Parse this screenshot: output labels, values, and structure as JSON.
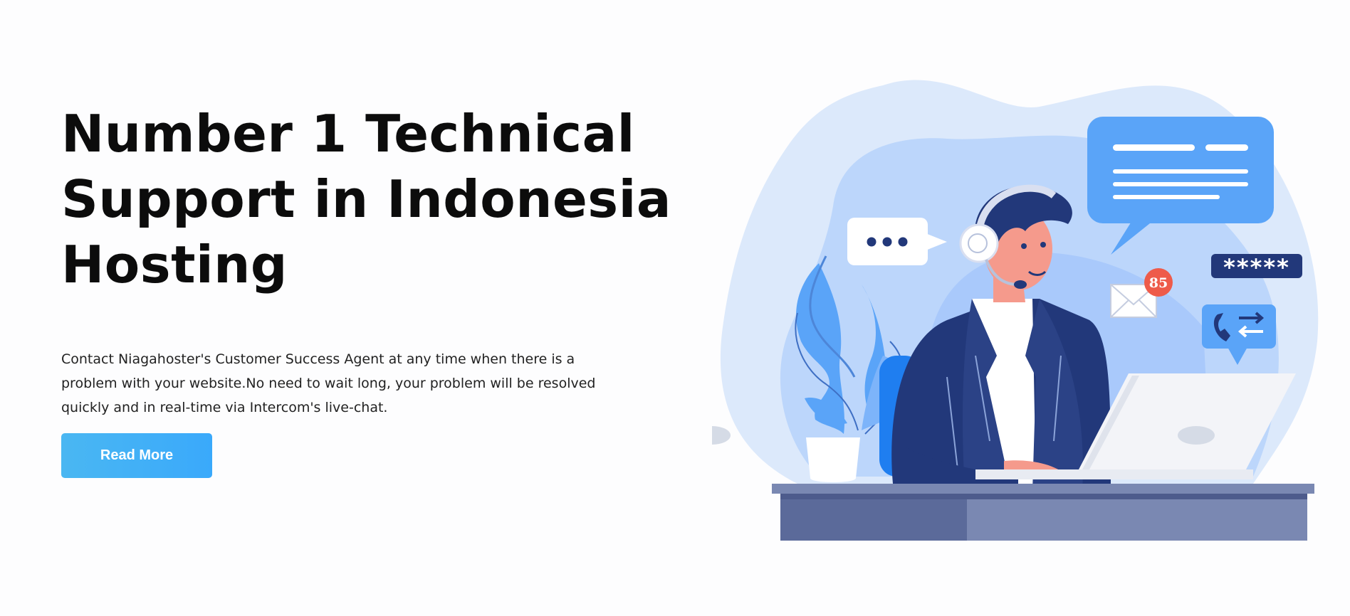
{
  "hero": {
    "title": "Number 1 Technical\nSupport in Indonesia\nHosting",
    "description": "Contact Niagahoster's Customer Success Agent at any time when there is a problem with your website.No need to wait long, your problem will be resolved quickly and in real-time via Intercom's live-chat.",
    "button_label": "Read More"
  },
  "illustration": {
    "notification_count": "85",
    "password_mask": "*****",
    "colors": {
      "blob_light": "#dce9fb",
      "blob_mid": "#bcd6fb",
      "accent_blue": "#5aa4f8",
      "navy": "#22387a",
      "desk_dark": "#5b6a9a",
      "desk_light": "#7a88b2"
    },
    "icons": [
      "chat-bubble-icon",
      "typing-bubble-icon",
      "envelope-icon",
      "password-badge-icon",
      "phone-transfer-icon",
      "plant-icon",
      "laptop-icon",
      "headset-icon"
    ]
  }
}
